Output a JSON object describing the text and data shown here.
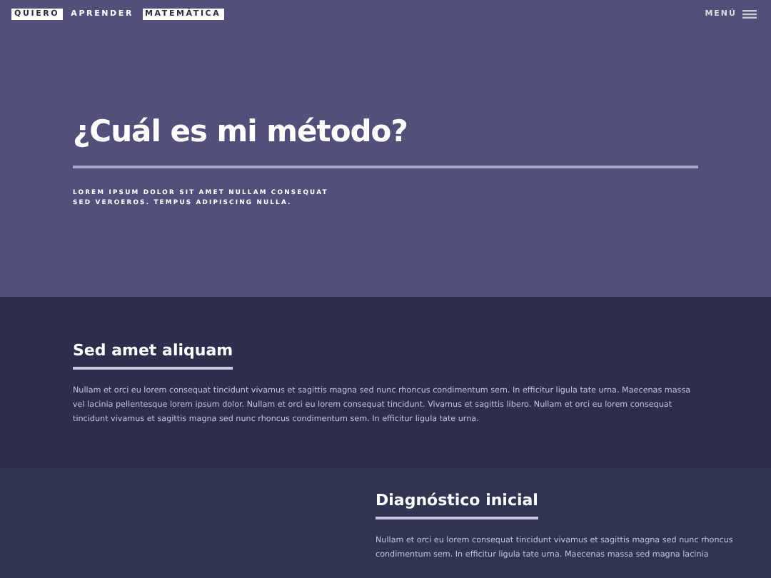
{
  "header": {
    "logo_words": [
      {
        "text": "QUIERO",
        "boxed": true
      },
      {
        "text": "APRENDER",
        "boxed": false
      },
      {
        "text": "MATEMÁTICA",
        "boxed": true
      }
    ],
    "menu_label": "MENÚ"
  },
  "hero": {
    "title": "¿Cuál es mi método?",
    "subtitle_lines": [
      "LOREM IPSUM DOLOR SIT AMET NULLAM CONSEQUAT",
      "SED VEROEROS. TEMPUS ADIPISCING NULLA."
    ]
  },
  "sections": [
    {
      "kind": "full",
      "heading": "Sed amet aliquam",
      "text": "Nullam et orci eu lorem consequat tincidunt vivamus et sagittis magna sed nunc rhoncus condimentum sem. In efficitur ligula tate urna. Maecenas massa vel lacinia pellentesque lorem ipsum dolor. Nullam et orci eu lorem consequat tincidunt. Vivamus et sagittis libero. Nullam et orci eu lorem consequat tincidunt vivamus et sagittis magna sed nunc rhoncus condimentum sem. In efficitur ligula tate urna."
    },
    {
      "kind": "right",
      "heading": "Diagnóstico inicial",
      "text": "Nullam et orci eu lorem consequat tincidunt vivamus et sagittis magna sed nunc rhoncus condimentum sem. In efficitur ligula tate urna. Maecenas massa sed magna lacinia"
    }
  ]
}
